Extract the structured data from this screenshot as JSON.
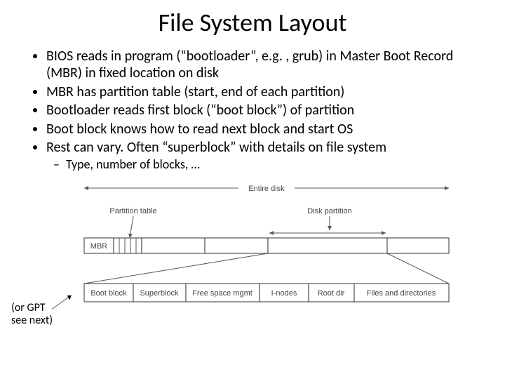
{
  "title": "File System Layout",
  "bullets": {
    "b1": "BIOS reads in program (“bootloader”, e.g. , grub) in Master Boot Record (MBR) in fixed location on disk",
    "b2": "MBR has partition table (start, end of each partition)",
    "b3": "Bootloader reads first block (“boot block”) of partition",
    "b4": "Boot block knows how to read next block and start OS",
    "b5": "Rest can vary. Often “superblock” with details on file system",
    "sub1": "Type, number of blocks, …"
  },
  "side_note": {
    "line1": "(or GPT",
    "line2": "see next)"
  },
  "diagram": {
    "top_label": "Entire disk",
    "ptr_partition_table": "Partition table",
    "ptr_disk_partition": "Disk partition",
    "mbr": "MBR",
    "blocks": {
      "boot": "Boot block",
      "super": "Superblock",
      "free": "Free space mgmt",
      "inodes": "I-nodes",
      "root": "Root dir",
      "files": "Files and directories"
    }
  }
}
